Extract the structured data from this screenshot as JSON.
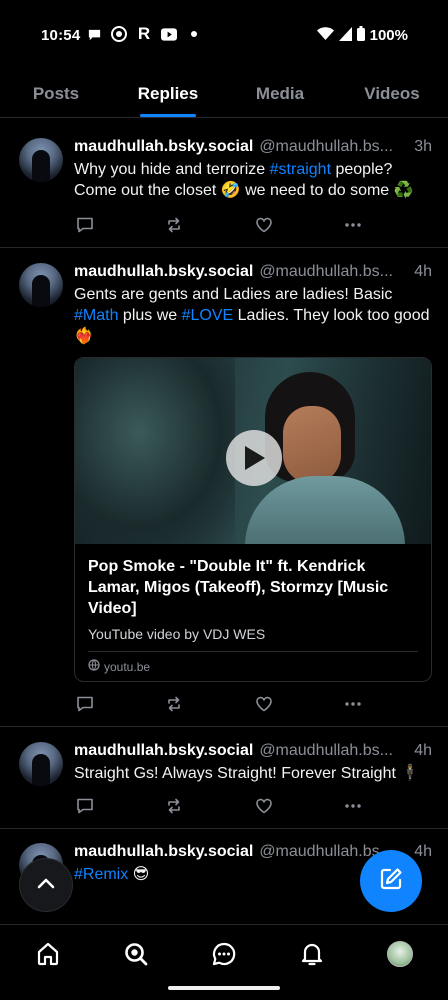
{
  "status_bar": {
    "time": "10:54",
    "battery": "100%"
  },
  "tabs": [
    {
      "label": "Posts"
    },
    {
      "label": "Replies"
    },
    {
      "label": "Media"
    },
    {
      "label": "Videos"
    }
  ],
  "posts": [
    {
      "display": "maudhullah.bsky.social",
      "handle": "@maudhullah.bs...",
      "time": "3h",
      "text_a": "Why you hide and terrorize ",
      "tag_a": "#straight",
      "text_b": " people? Come out the closet 🤣 we need to do some ♻️"
    },
    {
      "display": "maudhullah.bsky.social",
      "handle": "@maudhullah.bs...",
      "time": "4h",
      "text_a": "Gents are gents and Ladies are ladies! Basic ",
      "tag_a": "#Math",
      "text_b": " plus we ",
      "tag_b": "#LOVE",
      "text_c": " Ladies. They look too good❤️‍🔥",
      "embed": {
        "title": "Pop Smoke - \"Double It\" ft. Kendrick Lamar, Migos (Takeoff), Stormzy [Music Video]",
        "description": "YouTube video by VDJ WES",
        "domain": "youtu.be"
      }
    },
    {
      "display": "maudhullah.bsky.social",
      "handle": "@maudhullah.bs...",
      "time": "4h",
      "text_a": "Straight Gs! Always Straight! Forever Straight 🕴"
    },
    {
      "display": "maudhullah.bsky.social",
      "handle": "@maudhullah.bs...",
      "time": "4h",
      "tag_a": "#Remix",
      "text_b": " 😎"
    }
  ],
  "colors": {
    "accent": "#1083fe",
    "background": "#000000",
    "muted_text": "#8b8f97"
  },
  "icons": {
    "nav": [
      "home-icon",
      "search-icon",
      "chat-icon",
      "bell-icon",
      "profile-avatar"
    ],
    "post_actions": [
      "reply-icon",
      "repost-icon",
      "like-icon",
      "more-icon"
    ]
  }
}
